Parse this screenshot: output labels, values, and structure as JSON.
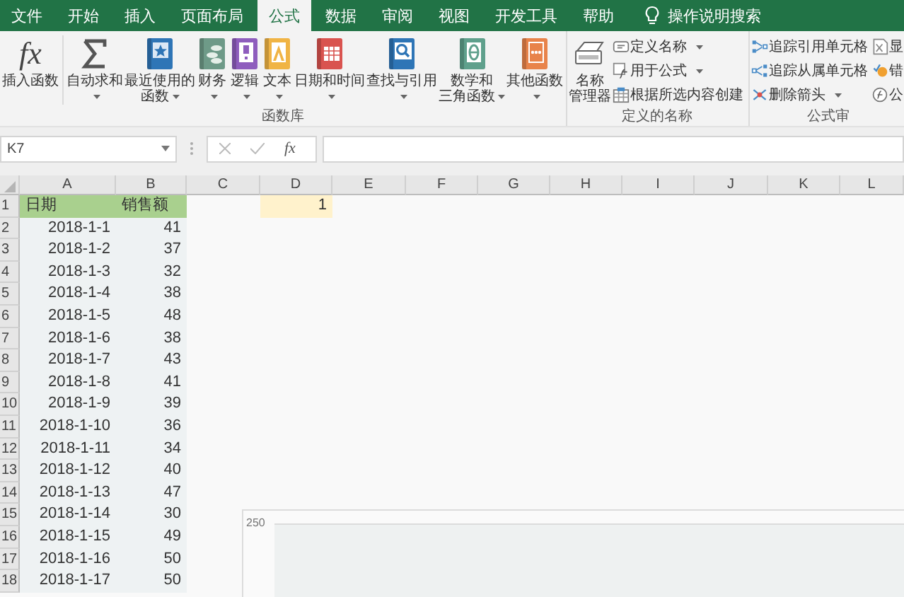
{
  "tabs": [
    {
      "label": "文件",
      "selected": false
    },
    {
      "label": "开始",
      "selected": false
    },
    {
      "label": "插入",
      "selected": false
    },
    {
      "label": "页面布局",
      "selected": false
    },
    {
      "label": "公式",
      "selected": true
    },
    {
      "label": "数据",
      "selected": false
    },
    {
      "label": "审阅",
      "selected": false
    },
    {
      "label": "视图",
      "selected": false
    },
    {
      "label": "开发工具",
      "selected": false
    },
    {
      "label": "帮助",
      "selected": false
    }
  ],
  "tell_me": "操作说明搜索",
  "ribbon_groups": [
    {
      "label": "函数库",
      "buttons": [
        {
          "kind": "big",
          "glyph": "fx",
          "lines": [
            "插入函数"
          ],
          "dropdown": false
        },
        {
          "kind": "big",
          "lines": [
            "自动求和"
          ],
          "dropdown": true
        },
        {
          "kind": "big",
          "lines": [
            "最近使用的",
            "函数"
          ],
          "dropdown": true
        },
        {
          "kind": "big",
          "lines": [
            "财务"
          ],
          "dropdown": true
        },
        {
          "kind": "big",
          "lines": [
            "逻辑"
          ],
          "dropdown": true
        },
        {
          "kind": "big",
          "lines": [
            "文本"
          ],
          "dropdown": true
        },
        {
          "kind": "big",
          "lines": [
            "日期和时间"
          ],
          "dropdown": true
        },
        {
          "kind": "big",
          "lines": [
            "查找与引用"
          ],
          "dropdown": true
        },
        {
          "kind": "big",
          "lines": [
            "数学和",
            "三角函数"
          ],
          "dropdown": true
        },
        {
          "kind": "big",
          "lines": [
            "其他函数"
          ],
          "dropdown": true
        }
      ]
    },
    {
      "label": "定义的名称",
      "buttons": [
        {
          "kind": "big",
          "lines": [
            "名称",
            "管理器"
          ],
          "dropdown": false
        },
        {
          "kind": "small",
          "lines": [
            "定义名称"
          ],
          "dropdown": true
        },
        {
          "kind": "small",
          "lines": [
            "用于公式"
          ],
          "dropdown": true
        },
        {
          "kind": "small",
          "lines": [
            "根据所选内容创建"
          ],
          "dropdown": false
        }
      ]
    },
    {
      "label": "公式审",
      "buttons": [
        {
          "kind": "small",
          "lines": [
            "追踪引用单元格"
          ],
          "dropdown": false
        },
        {
          "kind": "small",
          "lines": [
            "追踪从属单元格"
          ],
          "dropdown": false
        },
        {
          "kind": "small",
          "lines": [
            "删除箭头"
          ],
          "dropdown": true
        },
        {
          "kind": "small",
          "lines": [
            "显"
          ],
          "dropdown": false
        },
        {
          "kind": "small",
          "lines": [
            "错"
          ],
          "dropdown": false
        },
        {
          "kind": "small",
          "lines": [
            "公"
          ],
          "dropdown": false
        }
      ]
    }
  ],
  "formula_bar": {
    "name_box": "K7",
    "function_glyph": "fx"
  },
  "sheet": {
    "columns": [
      "A",
      "B",
      "C",
      "D",
      "E",
      "F",
      "G",
      "H",
      "I",
      "J",
      "K",
      "L"
    ],
    "rows": [
      {
        "number": "1",
        "kind": "header",
        "cells": {
          "A": {
            "value": "日期",
            "highlighted": false
          },
          "B": {
            "value": "销售额",
            "highlighted": false
          },
          "D": {
            "value": "1",
            "highlighted": true
          }
        }
      },
      {
        "number": "2",
        "kind": "data",
        "cells": {
          "A": {
            "value": "2018-1-1",
            "highlighted": false
          },
          "B": {
            "value": "41",
            "highlighted": false
          }
        }
      },
      {
        "number": "3",
        "kind": "data",
        "cells": {
          "A": {
            "value": "2018-1-2",
            "highlighted": false
          },
          "B": {
            "value": "37",
            "highlighted": false
          }
        }
      },
      {
        "number": "4",
        "kind": "data",
        "cells": {
          "A": {
            "value": "2018-1-3",
            "highlighted": false
          },
          "B": {
            "value": "32",
            "highlighted": false
          }
        }
      },
      {
        "number": "5",
        "kind": "data",
        "cells": {
          "A": {
            "value": "2018-1-4",
            "highlighted": false
          },
          "B": {
            "value": "38",
            "highlighted": false
          }
        }
      },
      {
        "number": "6",
        "kind": "data",
        "cells": {
          "A": {
            "value": "2018-1-5",
            "highlighted": false
          },
          "B": {
            "value": "48",
            "highlighted": false
          }
        }
      },
      {
        "number": "7",
        "kind": "data",
        "cells": {
          "A": {
            "value": "2018-1-6",
            "highlighted": false
          },
          "B": {
            "value": "38",
            "highlighted": false
          }
        }
      },
      {
        "number": "8",
        "kind": "data",
        "cells": {
          "A": {
            "value": "2018-1-7",
            "highlighted": false
          },
          "B": {
            "value": "43",
            "highlighted": false
          }
        }
      },
      {
        "number": "9",
        "kind": "data",
        "cells": {
          "A": {
            "value": "2018-1-8",
            "highlighted": false
          },
          "B": {
            "value": "41",
            "highlighted": false
          }
        }
      },
      {
        "number": "10",
        "kind": "data",
        "cells": {
          "A": {
            "value": "2018-1-9",
            "highlighted": false
          },
          "B": {
            "value": "39",
            "highlighted": false
          }
        }
      },
      {
        "number": "11",
        "kind": "data",
        "cells": {
          "A": {
            "value": "2018-1-10",
            "highlighted": false
          },
          "B": {
            "value": "36",
            "highlighted": false
          }
        }
      },
      {
        "number": "12",
        "kind": "data",
        "cells": {
          "A": {
            "value": "2018-1-11",
            "highlighted": false
          },
          "B": {
            "value": "34",
            "highlighted": false
          }
        }
      },
      {
        "number": "13",
        "kind": "data",
        "cells": {
          "A": {
            "value": "2018-1-12",
            "highlighted": false
          },
          "B": {
            "value": "40",
            "highlighted": false
          }
        }
      },
      {
        "number": "14",
        "kind": "data",
        "cells": {
          "A": {
            "value": "2018-1-13",
            "highlighted": false
          },
          "B": {
            "value": "47",
            "highlighted": false
          }
        }
      },
      {
        "number": "15",
        "kind": "data",
        "cells": {
          "A": {
            "value": "2018-1-14",
            "highlighted": false
          },
          "B": {
            "value": "30",
            "highlighted": false
          }
        }
      },
      {
        "number": "16",
        "kind": "data",
        "cells": {
          "A": {
            "value": "2018-1-15",
            "highlighted": false
          },
          "B": {
            "value": "49",
            "highlighted": false
          }
        }
      },
      {
        "number": "17",
        "kind": "data",
        "cells": {
          "A": {
            "value": "2018-1-16",
            "highlighted": false
          },
          "B": {
            "value": "50",
            "highlighted": false
          }
        }
      },
      {
        "number": "18",
        "kind": "data",
        "cells": {
          "A": {
            "value": "2018-1-17",
            "highlighted": false
          },
          "B": {
            "value": "50",
            "highlighted": false
          }
        }
      }
    ],
    "chart": {
      "axis_label": "250"
    }
  }
}
